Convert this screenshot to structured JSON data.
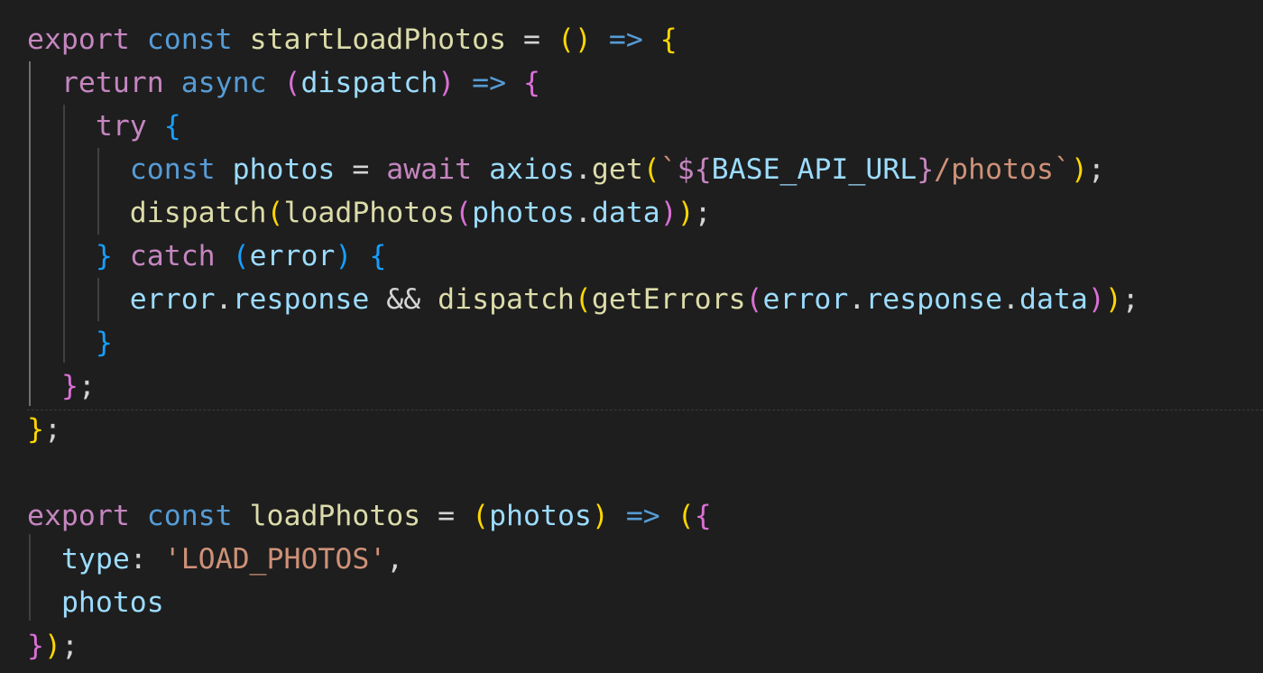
{
  "lines": [
    [
      {
        "t": "export",
        "c": "kw-pink"
      },
      {
        "t": " "
      },
      {
        "t": "const",
        "c": "kw-blue"
      },
      {
        "t": " "
      },
      {
        "t": "startLoadPhotos",
        "c": "fn"
      },
      {
        "t": " = ",
        "c": "pn"
      },
      {
        "t": "()",
        "c": "b1"
      },
      {
        "t": " "
      },
      {
        "t": "=>",
        "c": "kw-blue"
      },
      {
        "t": " "
      },
      {
        "t": "{",
        "c": "b1"
      }
    ],
    [
      {
        "t": "  "
      },
      {
        "t": "return",
        "c": "kw-pink"
      },
      {
        "t": " "
      },
      {
        "t": "async",
        "c": "kw-blue"
      },
      {
        "t": " "
      },
      {
        "t": "(",
        "c": "b2"
      },
      {
        "t": "dispatch",
        "c": "var"
      },
      {
        "t": ")",
        "c": "b2"
      },
      {
        "t": " "
      },
      {
        "t": "=>",
        "c": "kw-blue"
      },
      {
        "t": " "
      },
      {
        "t": "{",
        "c": "b2"
      }
    ],
    [
      {
        "t": "    "
      },
      {
        "t": "try",
        "c": "kw-pink"
      },
      {
        "t": " "
      },
      {
        "t": "{",
        "c": "b3"
      }
    ],
    [
      {
        "t": "      "
      },
      {
        "t": "const",
        "c": "kw-blue"
      },
      {
        "t": " "
      },
      {
        "t": "photos",
        "c": "var"
      },
      {
        "t": " = ",
        "c": "pn"
      },
      {
        "t": "await",
        "c": "kw-pink"
      },
      {
        "t": " "
      },
      {
        "t": "axios",
        "c": "var"
      },
      {
        "t": ".",
        "c": "pn"
      },
      {
        "t": "get",
        "c": "fn"
      },
      {
        "t": "(",
        "c": "b1"
      },
      {
        "t": "`",
        "c": "str"
      },
      {
        "t": "${",
        "c": "kw-pink"
      },
      {
        "t": "BASE_API_URL",
        "c": "var"
      },
      {
        "t": "}",
        "c": "kw-pink"
      },
      {
        "t": "/photos`",
        "c": "str"
      },
      {
        "t": ")",
        "c": "b1"
      },
      {
        "t": ";",
        "c": "pn"
      }
    ],
    [
      {
        "t": "      "
      },
      {
        "t": "dispatch",
        "c": "fn"
      },
      {
        "t": "(",
        "c": "b1"
      },
      {
        "t": "loadPhotos",
        "c": "fn"
      },
      {
        "t": "(",
        "c": "b2"
      },
      {
        "t": "photos",
        "c": "var"
      },
      {
        "t": ".",
        "c": "pn"
      },
      {
        "t": "data",
        "c": "var"
      },
      {
        "t": ")",
        "c": "b2"
      },
      {
        "t": ")",
        "c": "b1"
      },
      {
        "t": ";",
        "c": "pn"
      }
    ],
    [
      {
        "t": "    "
      },
      {
        "t": "}",
        "c": "b3"
      },
      {
        "t": " "
      },
      {
        "t": "catch",
        "c": "kw-pink"
      },
      {
        "t": " "
      },
      {
        "t": "(",
        "c": "b3"
      },
      {
        "t": "error",
        "c": "var"
      },
      {
        "t": ")",
        "c": "b3"
      },
      {
        "t": " "
      },
      {
        "t": "{",
        "c": "b3"
      }
    ],
    [
      {
        "t": "      "
      },
      {
        "t": "error",
        "c": "var"
      },
      {
        "t": ".",
        "c": "pn"
      },
      {
        "t": "response",
        "c": "var"
      },
      {
        "t": " && ",
        "c": "pn"
      },
      {
        "t": "dispatch",
        "c": "fn"
      },
      {
        "t": "(",
        "c": "b1"
      },
      {
        "t": "getErrors",
        "c": "fn"
      },
      {
        "t": "(",
        "c": "b2"
      },
      {
        "t": "error",
        "c": "var"
      },
      {
        "t": ".",
        "c": "pn"
      },
      {
        "t": "response",
        "c": "var"
      },
      {
        "t": ".",
        "c": "pn"
      },
      {
        "t": "data",
        "c": "var"
      },
      {
        "t": ")",
        "c": "b2"
      },
      {
        "t": ")",
        "c": "b1"
      },
      {
        "t": ";",
        "c": "pn"
      }
    ],
    [
      {
        "t": "    "
      },
      {
        "t": "}",
        "c": "b3"
      }
    ],
    [
      {
        "t": "  "
      },
      {
        "t": "}",
        "c": "b2"
      },
      {
        "t": ";",
        "c": "pn"
      }
    ],
    [
      {
        "t": "}",
        "c": "b1"
      },
      {
        "t": ";",
        "c": "pn"
      }
    ],
    [],
    [
      {
        "t": "export",
        "c": "kw-pink"
      },
      {
        "t": " "
      },
      {
        "t": "const",
        "c": "kw-blue"
      },
      {
        "t": " "
      },
      {
        "t": "loadPhotos",
        "c": "fn"
      },
      {
        "t": " = ",
        "c": "pn"
      },
      {
        "t": "(",
        "c": "b1"
      },
      {
        "t": "photos",
        "c": "var"
      },
      {
        "t": ")",
        "c": "b1"
      },
      {
        "t": " "
      },
      {
        "t": "=>",
        "c": "kw-blue"
      },
      {
        "t": " "
      },
      {
        "t": "(",
        "c": "b1"
      },
      {
        "t": "{",
        "c": "b2"
      }
    ],
    [
      {
        "t": "  "
      },
      {
        "t": "type",
        "c": "var"
      },
      {
        "t": ": ",
        "c": "pn"
      },
      {
        "t": "'LOAD_PHOTOS'",
        "c": "str"
      },
      {
        "t": ",",
        "c": "pn"
      }
    ],
    [
      {
        "t": "  "
      },
      {
        "t": "photos",
        "c": "var"
      }
    ],
    [
      {
        "t": "}",
        "c": "b2"
      },
      {
        "t": ")",
        "c": "b1"
      },
      {
        "t": ";",
        "c": "pn"
      }
    ]
  ]
}
